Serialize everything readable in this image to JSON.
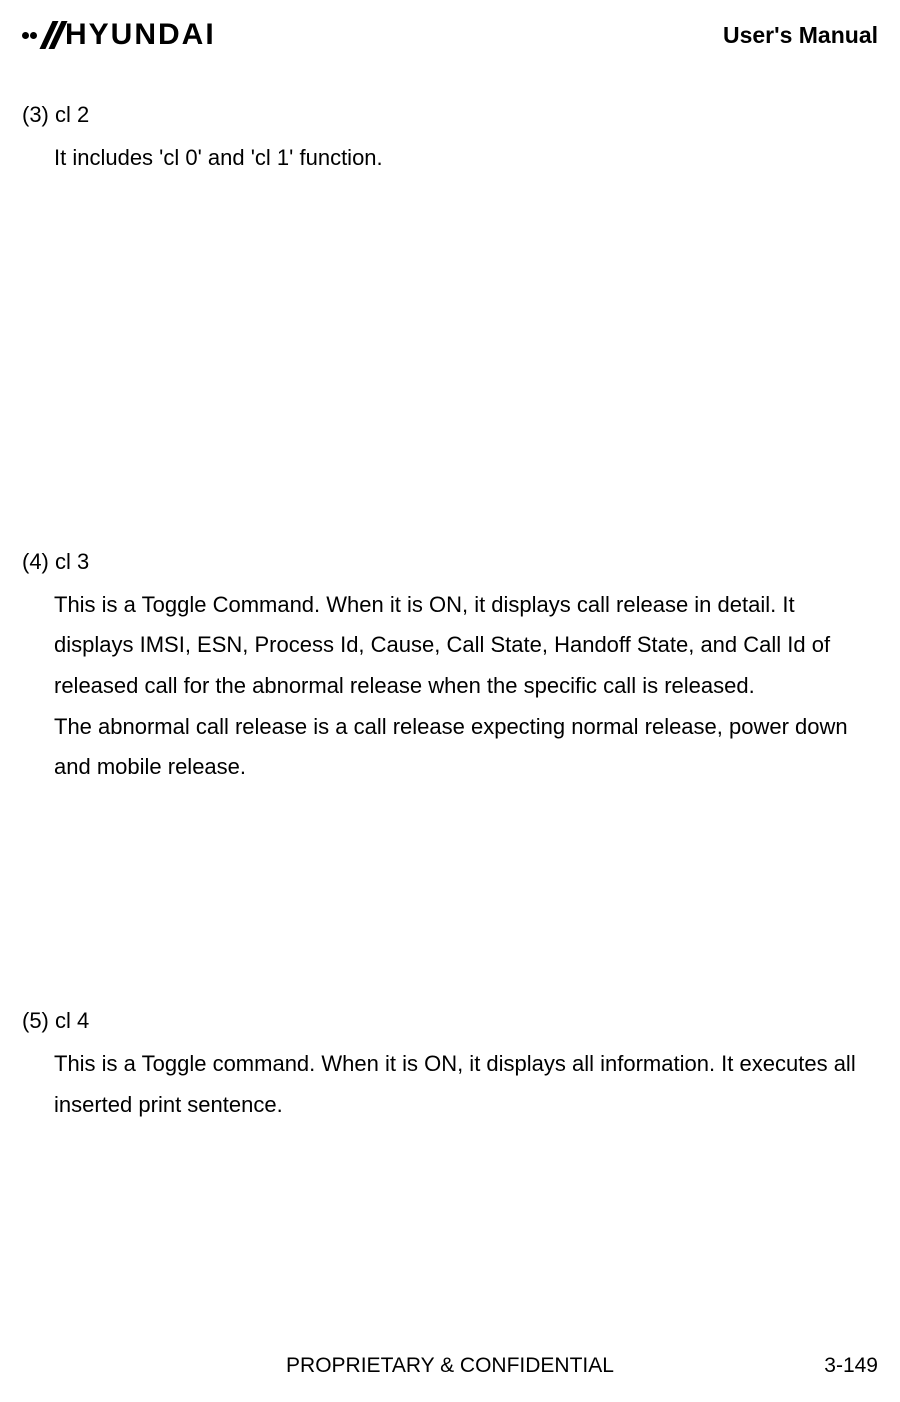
{
  "header": {
    "logo_text": "HYUNDAI",
    "manual_label": "User's Manual"
  },
  "sections": {
    "s3": {
      "title": "(3) cl 2",
      "body": "It includes 'cl 0' and 'cl 1' function."
    },
    "s4": {
      "title": "(4) cl 3",
      "body1": "This is a Toggle Command. When it is ON, it displays call release in detail. It displays IMSI, ESN, Process Id, Cause, Call State, Handoff State, and Call Id of released call for the abnormal release when the specific call is released.",
      "body2": "The abnormal call release is a call release expecting normal release, power down and mobile release."
    },
    "s5": {
      "title": "(5) cl 4",
      "body": "This is a Toggle command. When it is ON, it displays all information. It executes all inserted print sentence."
    }
  },
  "footer": {
    "center": "PROPRIETARY & CONFIDENTIAL",
    "page": "3-149"
  }
}
